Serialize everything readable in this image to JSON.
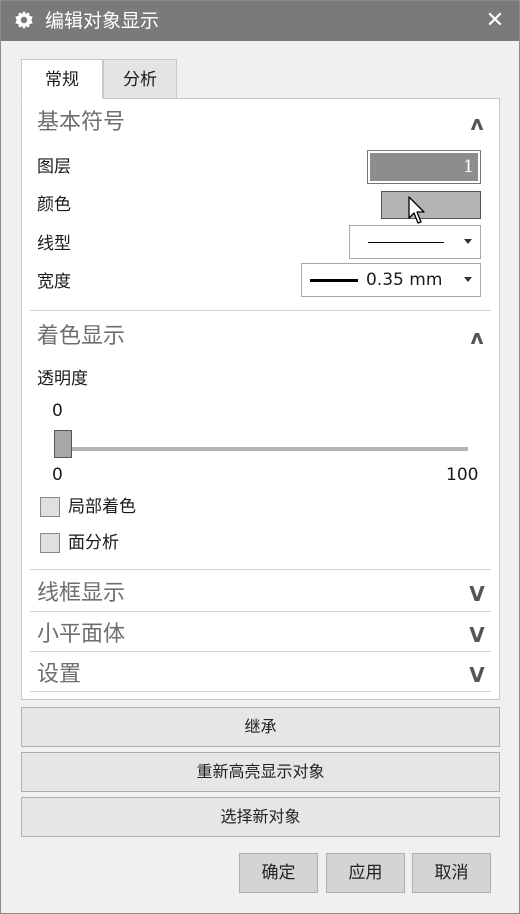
{
  "window": {
    "title": "编辑对象显示",
    "close_glyph": "✕",
    "gear_icon": "gear-icon",
    "close_icon": "close-icon"
  },
  "tabs": [
    {
      "label": "常规",
      "active": true
    },
    {
      "label": "分析",
      "active": false
    }
  ],
  "basic_symbol": {
    "title": "基本符号",
    "chevron": "ʌ",
    "layer": {
      "label": "图层",
      "value": "1"
    },
    "color": {
      "label": "颜色",
      "swatch": "#b4b4b4"
    },
    "linetype": {
      "label": "线型"
    },
    "width": {
      "label": "宽度",
      "value": "0.35 mm"
    }
  },
  "shading": {
    "title": "着色显示",
    "chevron": "ʌ",
    "transparency": {
      "label": "透明度",
      "value": "0",
      "min": "0",
      "max": "100",
      "level": 0
    },
    "local_shading": {
      "label": "局部着色",
      "checked": false
    },
    "face_analysis": {
      "label": "面分析",
      "checked": false
    }
  },
  "collapsed_sections": [
    {
      "title": "线框显示",
      "chevron": "V"
    },
    {
      "title": "小平面体",
      "chevron": "V"
    },
    {
      "title": "设置",
      "chevron": "V"
    }
  ],
  "actions": {
    "inherit": "继承",
    "rehighlight": "重新高亮显示对象",
    "select_new": "选择新对象"
  },
  "footer": {
    "ok": "确定",
    "apply": "应用",
    "cancel": "取消"
  },
  "colors": {
    "titlebar": "#7a7a7a",
    "panel_bg": "#ffffff",
    "dialog_bg": "#f0f0f0"
  }
}
